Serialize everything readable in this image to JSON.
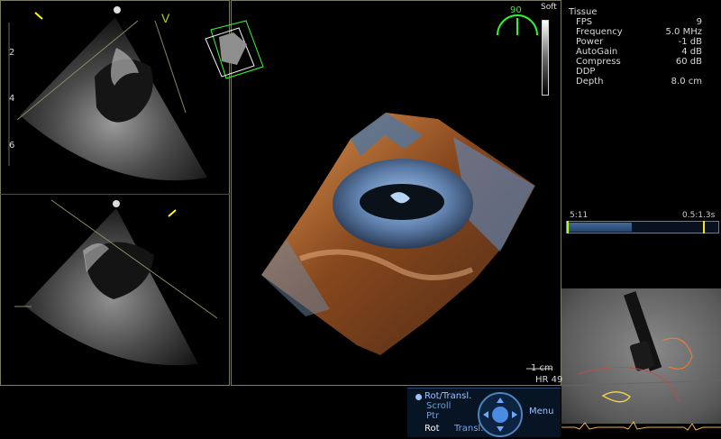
{
  "colors": {
    "frame": "#7b7b62",
    "marker": "#ffff00",
    "accent": "#1fb11f"
  },
  "left_top_view": {
    "scale_numbers": [
      "2",
      "4",
      "6"
    ],
    "v_label": "V"
  },
  "left_bottom_view": {},
  "right_info": {
    "title": "Tissue",
    "params": [
      {
        "name": "FPS",
        "value": "9"
      },
      {
        "name": "Frequency",
        "value": "5.0 MHz"
      },
      {
        "name": "Power",
        "value": "-1 dB"
      },
      {
        "name": "AutoGain",
        "value": "4 dB"
      },
      {
        "name": "Compress",
        "value": "60 dB"
      },
      {
        "name": "DDP",
        "value": ""
      },
      {
        "name": "Depth",
        "value": "8.0 cm"
      }
    ]
  },
  "gauge": {
    "value": "90",
    "label": "Soft"
  },
  "scale": {
    "label": "1 cm"
  },
  "heart_rate": {
    "label": "HR 49"
  },
  "timeline": {
    "start": "5:11",
    "end": "0.5:1.3s",
    "progress": 0.42
  },
  "controls": {
    "mode_label": "Rot/Transl.",
    "scroll_label": "Scroll",
    "ptr_label": "Ptr",
    "rot_label": "Rot",
    "transl_label": "Transl.",
    "menu_label": "Menu"
  }
}
